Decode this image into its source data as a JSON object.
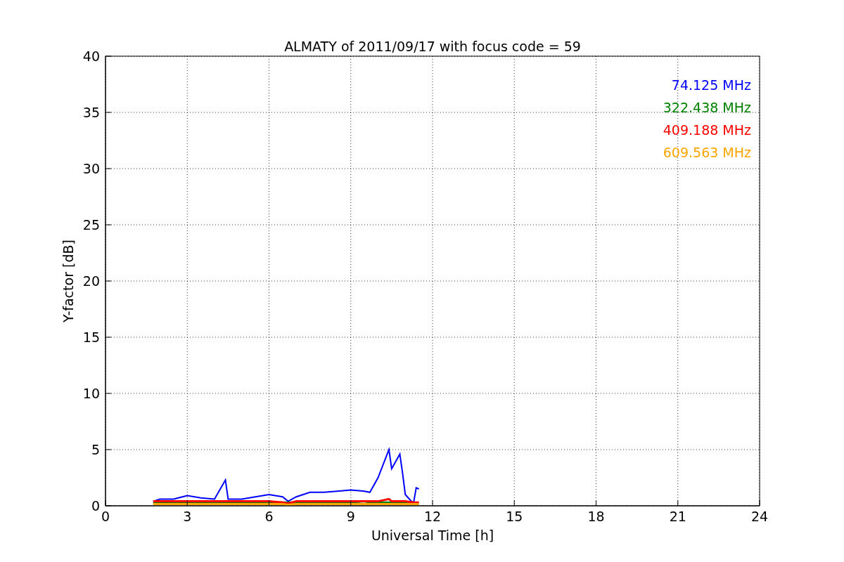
{
  "chart_data": {
    "type": "line",
    "title": "ALMATY of 2011/09/17 with focus code = 59",
    "xlabel": "Universal Time [h]",
    "ylabel": "Y-factor [dB]",
    "x": [
      1.75,
      2,
      2.5,
      3,
      3.5,
      4,
      4.4,
      4.5,
      5,
      5.5,
      6,
      6.5,
      6.7,
      7,
      7.5,
      8,
      8.5,
      9,
      9.5,
      9.7,
      10,
      10.4,
      10.5,
      10.8,
      10.9,
      11,
      11.3,
      11.4,
      11.5
    ],
    "series": [
      {
        "name": "74.125 MHz",
        "color": "#0000ff",
        "values": [
          0.4,
          0.6,
          0.6,
          0.9,
          0.7,
          0.6,
          2.3,
          0.6,
          0.6,
          0.8,
          1.0,
          0.8,
          0.4,
          0.8,
          1.2,
          1.2,
          1.3,
          1.4,
          1.3,
          1.2,
          2.5,
          5.0,
          3.3,
          4.6,
          2.9,
          1.0,
          0.2,
          1.6,
          1.5
        ]
      },
      {
        "name": "322.438 MHz",
        "color": "#008000",
        "values": [
          0.3,
          0.3,
          0.3,
          0.3,
          0.3,
          0.3,
          0.3,
          0.3,
          0.3,
          0.3,
          0.3,
          0.3,
          0.3,
          0.3,
          0.3,
          0.3,
          0.3,
          0.3,
          0.4,
          0.3,
          0.3,
          0.3,
          0.3,
          0.3,
          0.3,
          0.3,
          0.3,
          null,
          null
        ]
      },
      {
        "name": "409.188 MHz",
        "color": "#ff0000",
        "values": [
          0.4,
          0.4,
          0.4,
          0.4,
          0.4,
          0.4,
          0.4,
          0.4,
          0.4,
          0.4,
          0.4,
          0.3,
          0.2,
          0.4,
          0.4,
          0.4,
          0.4,
          0.4,
          0.4,
          0.4,
          0.4,
          0.6,
          0.4,
          0.4,
          0.4,
          0.4,
          0.3,
          0.3,
          0.3
        ]
      },
      {
        "name": "609.563 MHz",
        "color": "#ffa500",
        "values": [
          0.15,
          0.15,
          0.15,
          0.15,
          0.15,
          0.15,
          0.15,
          0.15,
          0.15,
          0.15,
          0.15,
          0.15,
          0.1,
          0.15,
          0.15,
          0.15,
          0.15,
          0.15,
          0.15,
          0.15,
          0.15,
          0.15,
          0.15,
          0.15,
          0.15,
          0.15,
          0.15,
          0.15,
          0.15
        ]
      }
    ],
    "grid": true,
    "xlim": [
      0,
      24
    ],
    "ylim": [
      0,
      40
    ],
    "xticks": [
      0,
      3,
      6,
      9,
      12,
      15,
      18,
      21,
      24
    ],
    "yticks": [
      0,
      5,
      10,
      15,
      20,
      25,
      30,
      35,
      40
    ]
  }
}
